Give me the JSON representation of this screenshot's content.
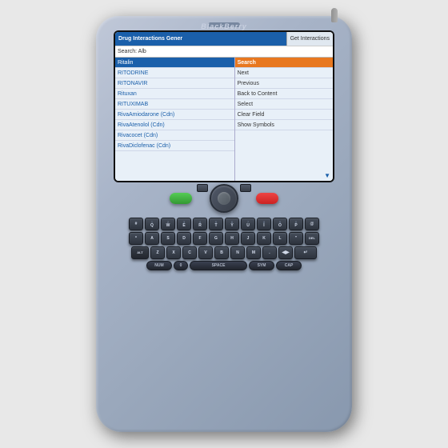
{
  "device": {
    "brand": "BlackBerry"
  },
  "screen": {
    "header": {
      "left": "Drug Interactions Gener",
      "right": "Get Interactions"
    },
    "search_bar": {
      "label": "Search: Alb"
    },
    "list": {
      "items": [
        {
          "label": "Ritalin",
          "selected": true
        },
        {
          "label": "RITODRINE",
          "selected": false
        },
        {
          "label": "RITONAVIR",
          "selected": false
        },
        {
          "label": "Rituxan",
          "selected": false
        },
        {
          "label": "RITUXIMAB",
          "selected": false
        },
        {
          "label": "RivaAmiodarone (Cdn)",
          "selected": false
        },
        {
          "label": "RivaAtenolol (Cdn)",
          "selected": false
        },
        {
          "label": "Rivacocet (Cdn)",
          "selected": false
        },
        {
          "label": "RivaDiclofenac (Cdn)",
          "selected": false
        }
      ]
    },
    "context_menu": {
      "items": [
        {
          "label": "Search",
          "highlighted": true
        },
        {
          "label": "Next",
          "highlighted": false
        },
        {
          "label": "Previous",
          "highlighted": false
        },
        {
          "label": "Back to Content",
          "highlighted": false
        },
        {
          "label": "Select",
          "highlighted": false
        },
        {
          "label": "Clear Field",
          "highlighted": false
        },
        {
          "label": "Show Symbols",
          "highlighted": false
        }
      ]
    }
  },
  "keyboard": {
    "rows": [
      [
        "Q",
        "W",
        "E",
        "R",
        "T",
        "Y",
        "U",
        "I",
        "O",
        "P"
      ],
      [
        "A",
        "S",
        "D",
        "F",
        "G",
        "H",
        "J",
        "K",
        "L"
      ],
      [
        "Z",
        "X",
        "C",
        "V",
        "B",
        "N",
        "M"
      ]
    ],
    "bottom_keys": [
      {
        "label": "NUM",
        "width": "wide"
      },
      {
        "label": "0",
        "width": "normal"
      },
      {
        "label": "SPACE",
        "width": "space"
      },
      {
        "label": "SYM",
        "width": "wide"
      },
      {
        "label": "CAP",
        "width": "wide"
      }
    ]
  }
}
